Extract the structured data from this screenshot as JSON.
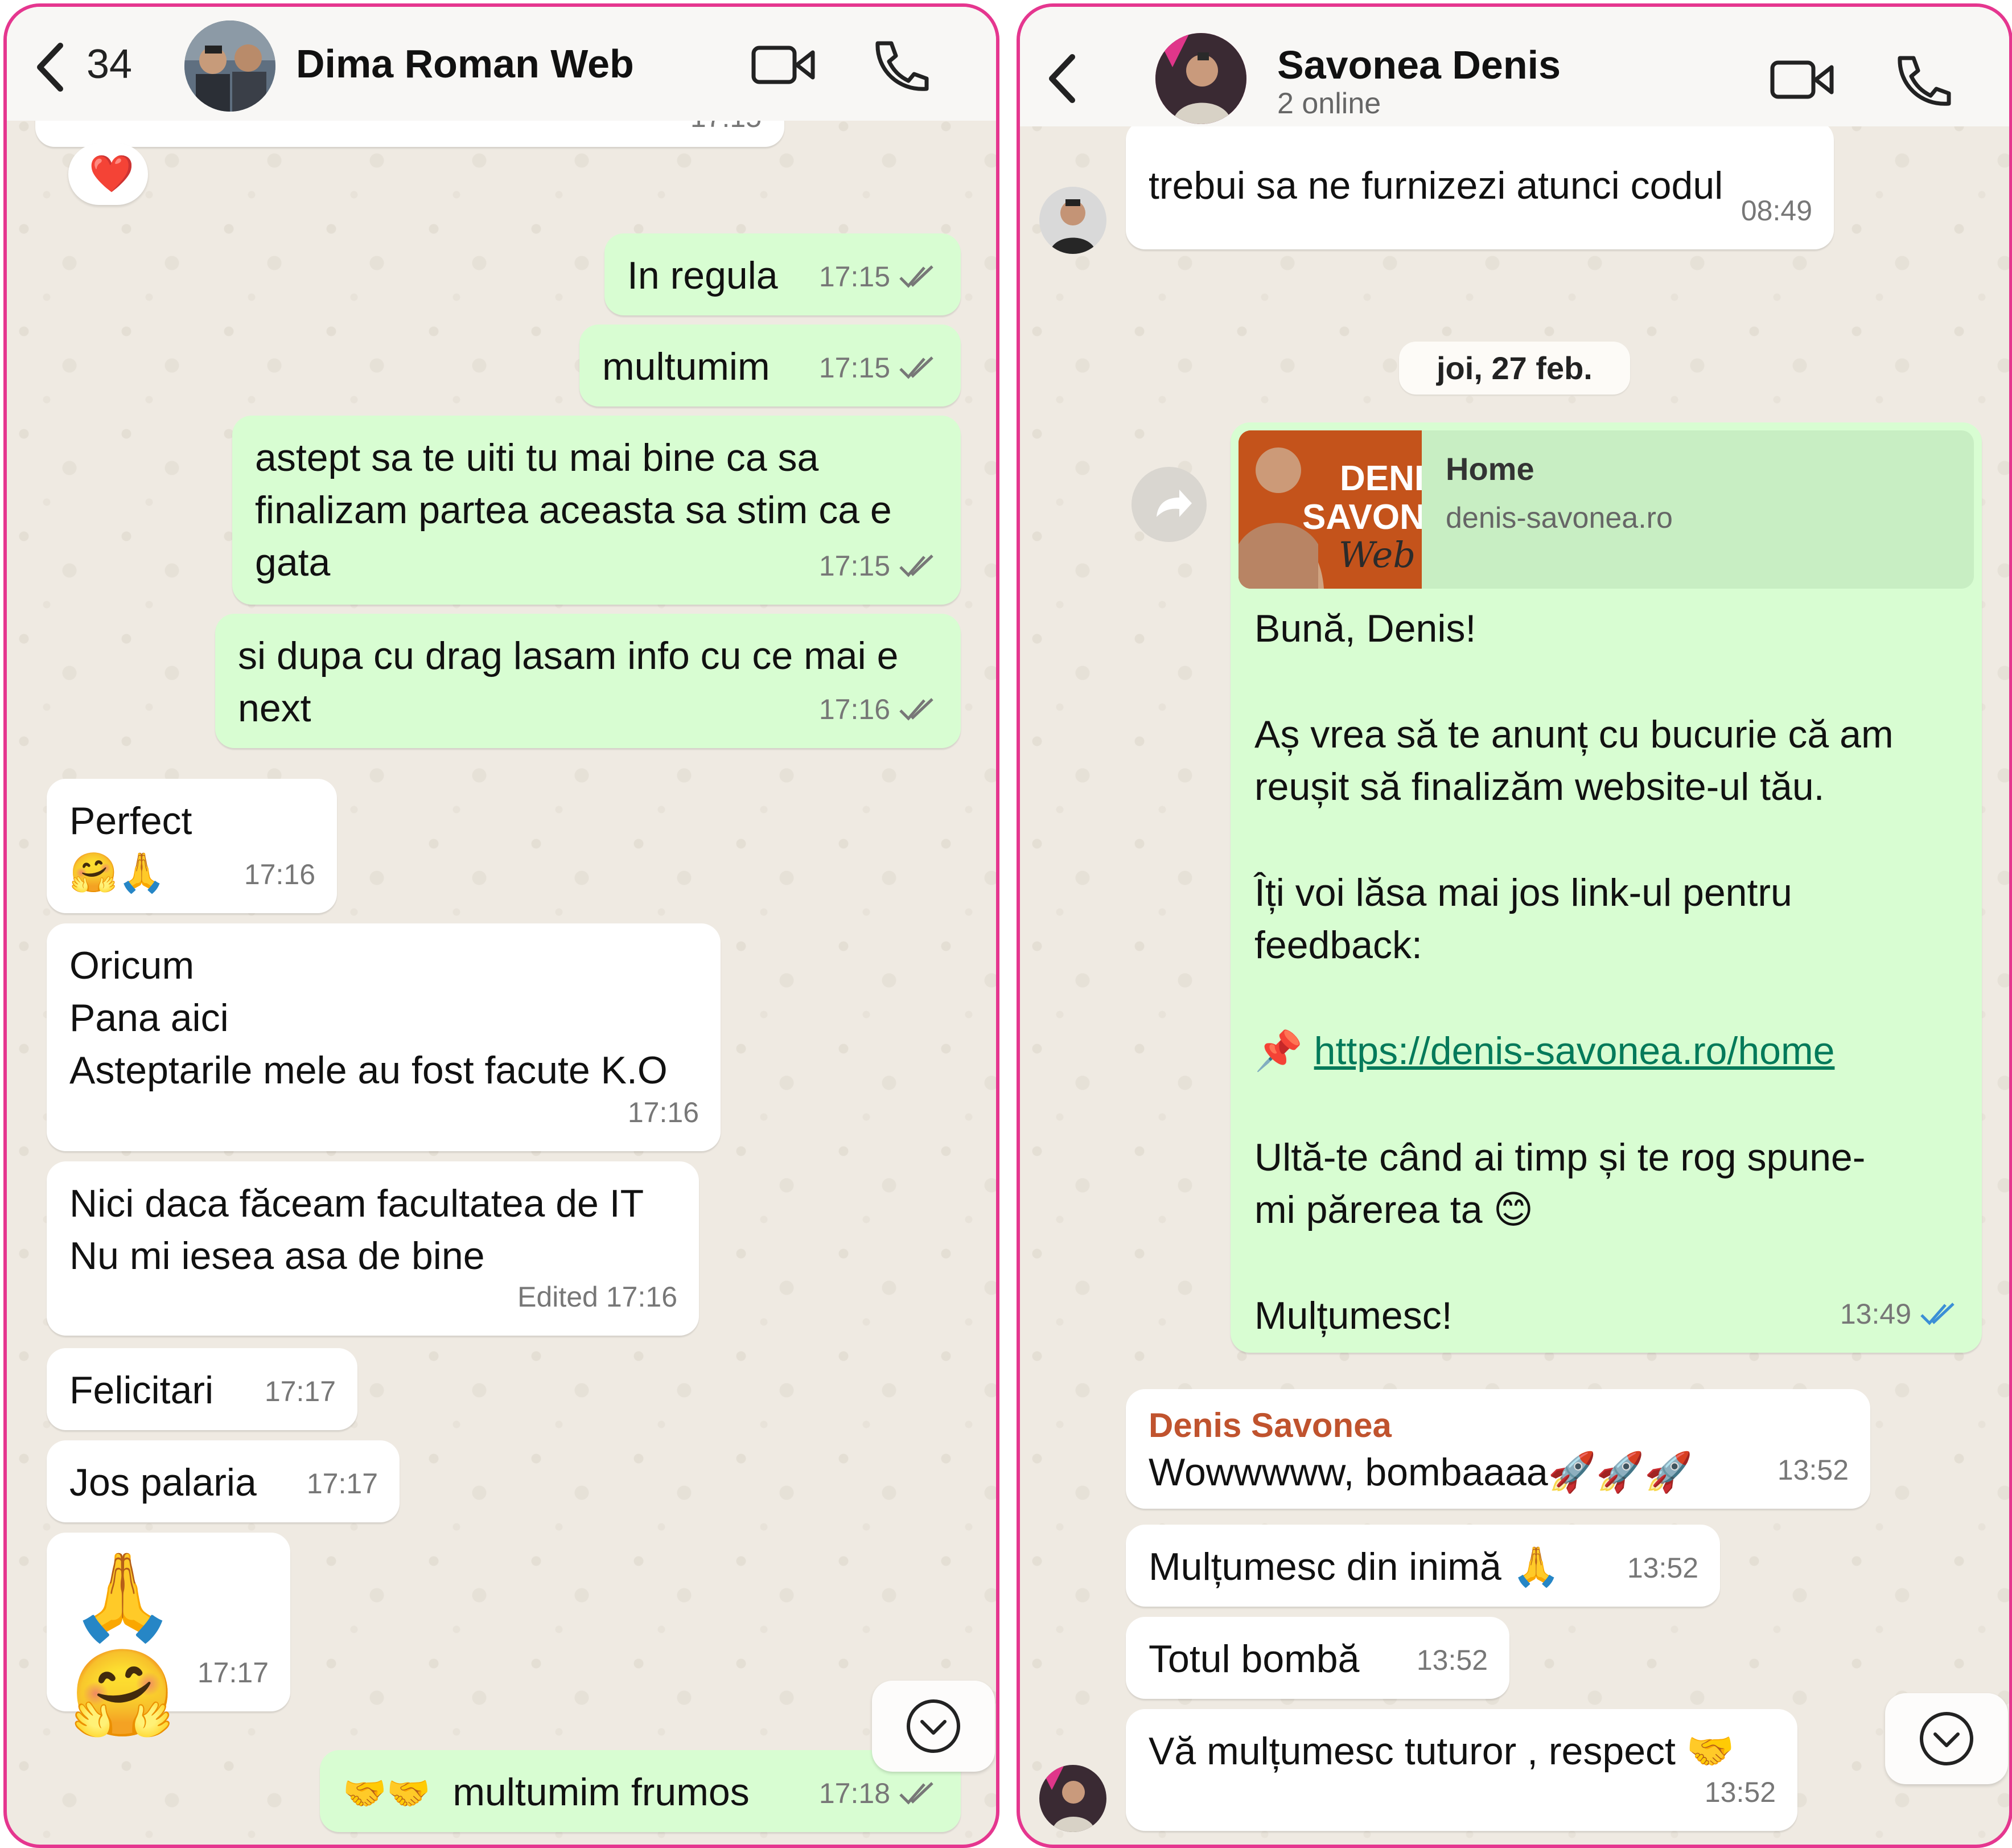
{
  "left_chat": {
    "header": {
      "back_count": "34",
      "contact_name": "Dima Roman Web"
    },
    "clipped_time": "17:15",
    "reaction": "❤️",
    "messages": [
      {
        "text": "In regula",
        "time": "17:15",
        "direction": "outgoing",
        "status": "read"
      },
      {
        "text": "multumim",
        "time": "17:15",
        "direction": "outgoing",
        "status": "read"
      },
      {
        "lines": [
          "astept sa te uiti tu mai bine ca sa",
          "finalizam partea aceasta sa stim ca e",
          "gata"
        ],
        "time": "17:15",
        "direction": "outgoing",
        "status": "read"
      },
      {
        "lines": [
          "si dupa cu drag lasam info cu ce mai e",
          "next"
        ],
        "time": "17:16",
        "direction": "outgoing",
        "status": "read"
      },
      {
        "lines": [
          "Perfect",
          "🤗🙏"
        ],
        "time": "17:16",
        "direction": "incoming"
      },
      {
        "lines": [
          "Oricum",
          "Pana aici",
          "Asteptarile mele au fost facute K.O"
        ],
        "time": "17:16",
        "direction": "incoming"
      },
      {
        "lines": [
          "Nici daca făceam facultatea de IT",
          "Nu mi iesea asa de bine"
        ],
        "time": "17:16",
        "edited_label": "Edited",
        "direction": "incoming"
      },
      {
        "text": "Felicitari",
        "time": "17:17",
        "direction": "incoming"
      },
      {
        "text": "Jos palaria",
        "time": "17:17",
        "direction": "incoming"
      },
      {
        "text": "🙏🤗",
        "time": "17:17",
        "direction": "incoming"
      },
      {
        "emoji": "🤝🤝",
        "text": "multumim frumos",
        "time": "17:18",
        "direction": "outgoing",
        "status": "read"
      }
    ]
  },
  "right_chat": {
    "header": {
      "contact_name": "Savonea Denis",
      "status": "2 online"
    },
    "messages_top": [
      {
        "text": "trebui sa ne furnizezi atunci codul",
        "time": "08:49",
        "direction": "incoming"
      }
    ],
    "date_separator": "joi, 27 feb.",
    "link_message": {
      "preview_title": "Home",
      "preview_domain": "denis-savonea.ro",
      "thumbnail_text": [
        "DENI",
        "SAVON",
        "Web"
      ],
      "greeting": "Bună, Denis!",
      "paragraph1": [
        "Aș vrea să te anunț cu bucurie că am",
        "reușit să finalizăm website-ul tău."
      ],
      "paragraph2": [
        "Îți voi lăsa mai jos link-ul pentru",
        "feedback:"
      ],
      "pin_emoji": "📌",
      "url": "https://denis-savonea.ro/home",
      "paragraph3": [
        "Ultă-te când ai timp și te rog spune-",
        "mi părerea ta 😊"
      ],
      "closing": "Mulțumesc!",
      "time": "13:49",
      "status": "read"
    },
    "messages_bottom": [
      {
        "sender": "Denis Savonea",
        "text": "Wowwwww, bombaaaa🚀🚀🚀",
        "time": "13:52",
        "direction": "incoming"
      },
      {
        "text": "Mulțumesc din inimă 🙏",
        "time": "13:52",
        "direction": "incoming"
      },
      {
        "text": "Totul bombă",
        "time": "13:52",
        "direction": "incoming"
      },
      {
        "text": "Vă mulțumesc tuturor , respect 🤝",
        "time": "13:52",
        "direction": "incoming"
      }
    ]
  },
  "colors": {
    "outgoing_bubble": "#d8fdd2",
    "incoming_bubble": "#ffffff",
    "chat_background": "#efeae2",
    "panel_border": "#e5368f",
    "sender_name": "#c0532e",
    "link": "#047a5a",
    "read_check": "#3b8fd6"
  },
  "icons": [
    "back-icon",
    "video-call-icon",
    "phone-icon",
    "scroll-down-icon",
    "forward-icon",
    "double-check-icon"
  ]
}
